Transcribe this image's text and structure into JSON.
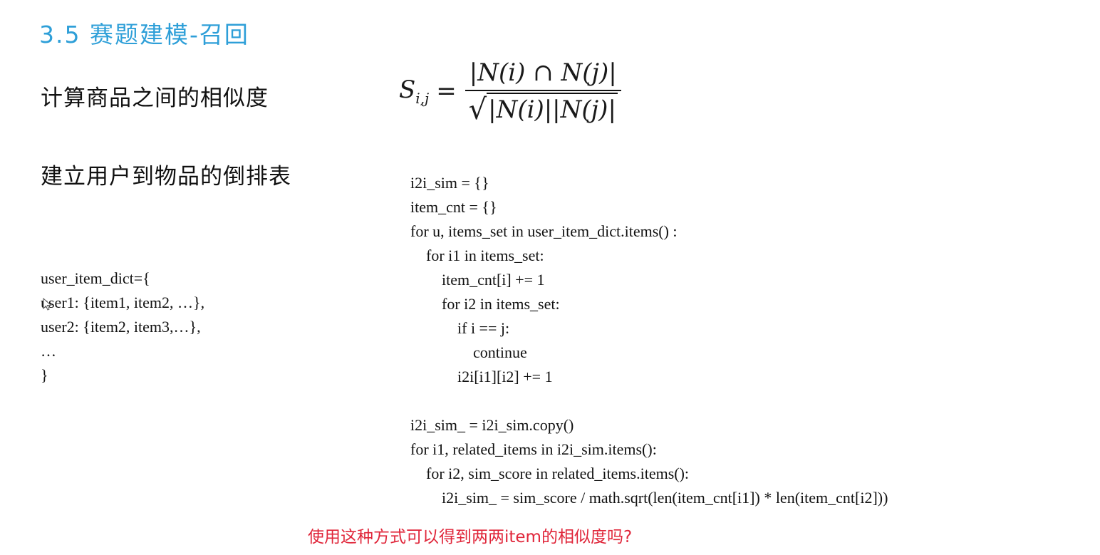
{
  "slide": {
    "title": "3.5 赛题建模-召回"
  },
  "headings": {
    "similarity": "计算商品之间的相似度",
    "inverted_index": "建立用户到物品的倒排表"
  },
  "formula": {
    "lhs": "S",
    "lhs_sub": "i,j",
    "equals": "=",
    "numerator": "|N(i) ∩ N(j)|",
    "sqrt": "√",
    "denominator": "|N(i)||N(j)|"
  },
  "dict_block": {
    "lines": [
      "user_item_dict={",
      "user1: {item1, item2, …},",
      "user2: {item2, item3,…},",
      "…",
      "}"
    ]
  },
  "code_block": {
    "lines": [
      "i2i_sim = {}",
      "item_cnt = {}",
      "for u, items_set in user_item_dict.items() :",
      "    for i1 in items_set:",
      "        item_cnt[i] += 1",
      "        for i2 in items_set:",
      "            if i == j:",
      "                continue",
      "            i2i[i1][i2] += 1",
      "",
      "i2i_sim_ = i2i_sim.copy()",
      "for i1, related_items in i2i_sim.items():",
      "    for i2, sim_score in related_items.items():",
      "        i2i_sim_ = sim_score / math.sqrt(len(item_cnt[i1]) * len(item_cnt[i2]))"
    ]
  },
  "question": "使用这种方式可以得到两两item的相似度吗?",
  "icons": {
    "cursor": "mouse-pointer-icon"
  }
}
